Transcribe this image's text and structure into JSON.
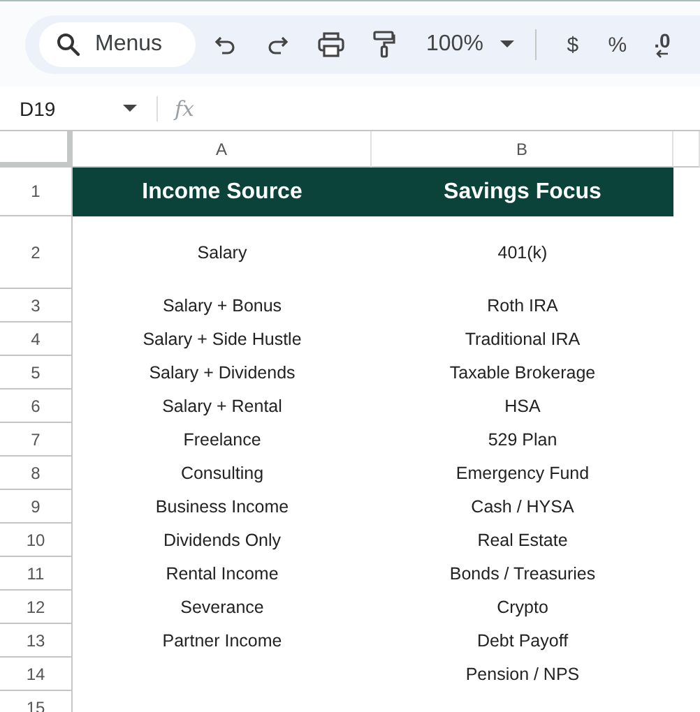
{
  "toolbar": {
    "search": {
      "placeholder": "Menus"
    },
    "zoom": "100%",
    "currency": "$",
    "percent": "%",
    "decrease_decimal": ".0"
  },
  "formula_bar": {
    "cell_ref": "D19",
    "fx": "fx"
  },
  "columns": [
    "A",
    "B"
  ],
  "rows": [
    {
      "number": "1",
      "kind": "header",
      "cells": [
        "Income Source",
        "Savings Focus"
      ]
    },
    {
      "number": "2",
      "kind": "tall",
      "cells": [
        "Salary",
        "401(k)"
      ]
    },
    {
      "number": "3",
      "kind": "plain",
      "cells": [
        "Salary + Bonus",
        "Roth IRA"
      ]
    },
    {
      "number": "4",
      "kind": "plain",
      "cells": [
        "Salary + Side Hustle",
        "Traditional IRA"
      ]
    },
    {
      "number": "5",
      "kind": "plain",
      "cells": [
        "Salary + Dividends",
        "Taxable Brokerage"
      ]
    },
    {
      "number": "6",
      "kind": "plain",
      "cells": [
        "Salary + Rental",
        "HSA"
      ]
    },
    {
      "number": "7",
      "kind": "plain",
      "cells": [
        "Freelance",
        "529 Plan"
      ]
    },
    {
      "number": "8",
      "kind": "plain",
      "cells": [
        "Consulting",
        "Emergency Fund"
      ]
    },
    {
      "number": "9",
      "kind": "plain",
      "cells": [
        "Business Income",
        "Cash / HYSA"
      ]
    },
    {
      "number": "10",
      "kind": "plain",
      "cells": [
        "Dividends Only",
        "Real Estate"
      ]
    },
    {
      "number": "11",
      "kind": "plain",
      "cells": [
        "Rental Income",
        "Bonds / Treasuries"
      ]
    },
    {
      "number": "12",
      "kind": "plain",
      "cells": [
        "Severance",
        "Crypto"
      ]
    },
    {
      "number": "13",
      "kind": "plain",
      "cells": [
        "Partner Income",
        "Debt Payoff"
      ]
    },
    {
      "number": "14",
      "kind": "plain",
      "cells": [
        null,
        "Pension / NPS"
      ]
    },
    {
      "number": "15",
      "kind": "plain",
      "cells": [
        null,
        null
      ]
    }
  ]
}
